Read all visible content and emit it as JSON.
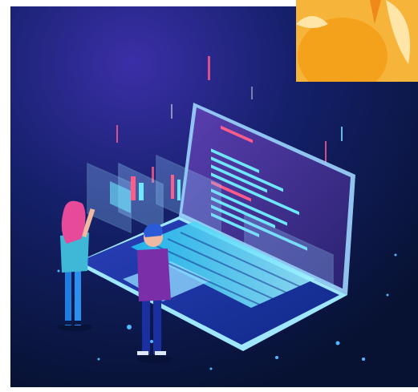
{
  "illustration": {
    "subject": "isometric-laptop-with-developers",
    "colors": {
      "background": "#0a1a4a",
      "glow": "#3b2fa8",
      "screen": "#3a2f8a",
      "code_cyan": "#6ee7ff",
      "code_pink": "#ff5c8a",
      "keyboard": "#1fc6f2"
    }
  },
  "logo_badge": {
    "colors": {
      "primary": "#f4a21c",
      "secondary": "#ffe6a8"
    }
  }
}
